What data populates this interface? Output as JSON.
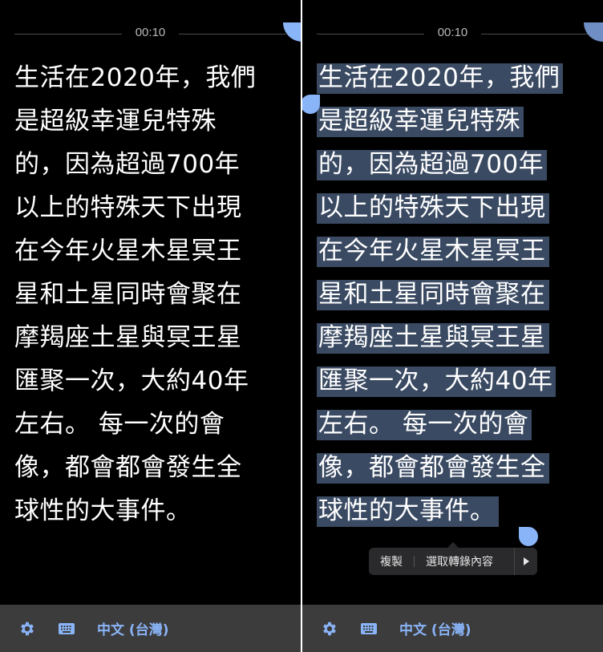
{
  "timer": "00:10",
  "transcript_lines": [
    "生活在2020年，我們",
    "是超級幸運兒特殊",
    "的，因為超過700年",
    "以上的特殊天下出現",
    "在今年火星木星冥王",
    "星和土星同時會聚在",
    "摩羯座土星與冥王星",
    "匯聚一次，大約40年",
    "左右。 每一次的會",
    "像，都會都會發生全",
    "球性的大事件。"
  ],
  "context_menu": {
    "copy_label": "複製",
    "select_transcript_label": "選取轉錄內容"
  },
  "bottom_bar": {
    "settings_icon": "gear-icon",
    "keyboard_icon": "keyboard-icon",
    "language_label": "中文 (台灣)"
  },
  "colors": {
    "background": "#000000",
    "text": "#ffffff",
    "accent": "#8ab4f8",
    "selection": "#3a4a62",
    "bottom_bar": "#3c3c3c"
  }
}
